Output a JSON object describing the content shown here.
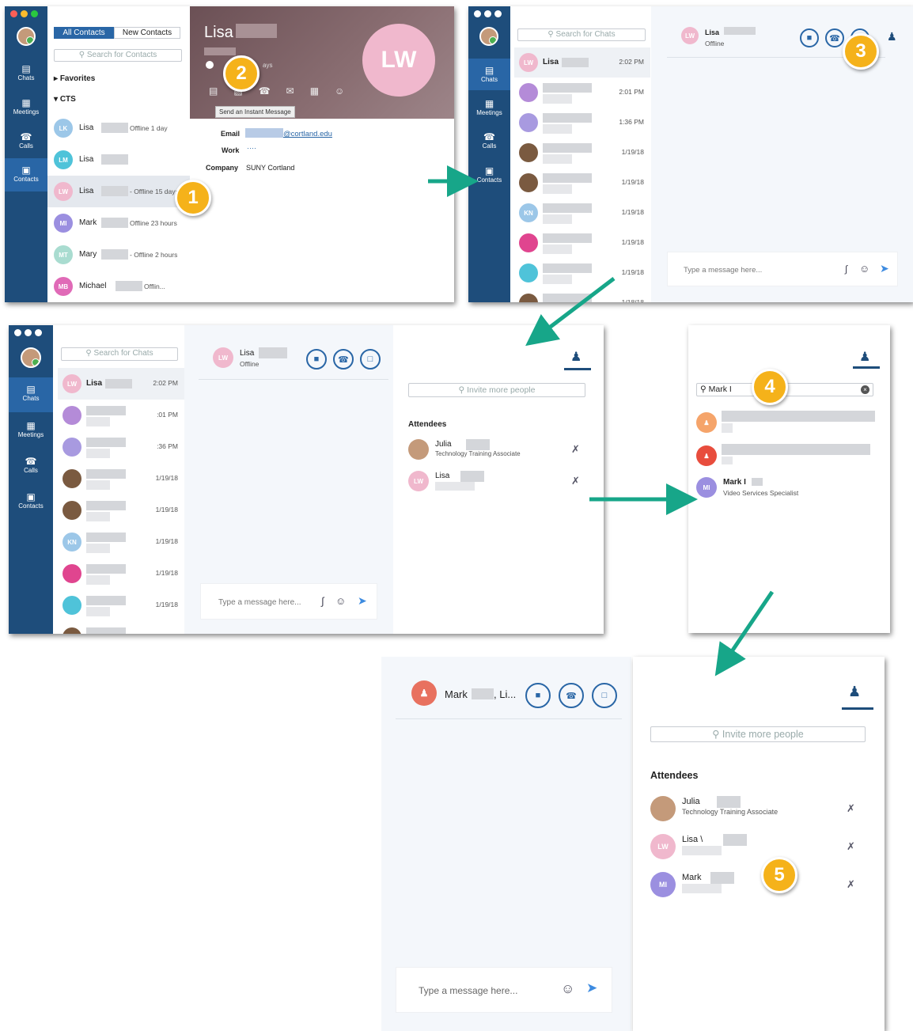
{
  "panel1": {
    "tabs": [
      "All Contacts",
      "New Contacts"
    ],
    "search_placeholder": "Search for Contacts",
    "groups": [
      "Favorites",
      "CTS"
    ],
    "nav": [
      "Chats",
      "Meetings",
      "Calls",
      "Contacts"
    ],
    "contacts": [
      {
        "initials": "LK",
        "name": "Lisa",
        "status": "Offline 1 day",
        "color": "#9cc7e8"
      },
      {
        "initials": "LM",
        "name": "Lisa",
        "status": "",
        "color": "#4fc3d9"
      },
      {
        "initials": "LW",
        "name": "Lisa",
        "status": "- Offline 15 days",
        "color": "#f0b8cd"
      },
      {
        "initials": "MI",
        "name": "Mark",
        "status": "Offline 23 hours",
        "color": "#9b8fe0"
      },
      {
        "initials": "MT",
        "name": "Mary",
        "status": "- Offline 2 hours",
        "color": "#a9dcd0"
      },
      {
        "initials": "MB",
        "name": "Michael",
        "status": "Offlin...",
        "color": "#e06ab7"
      }
    ],
    "profile": {
      "name": "Lisa",
      "initials": "LW",
      "status_fragment": "ays",
      "tooltip": "Send an Instant Message",
      "email_label": "Email",
      "email_value": "@cortland.edu",
      "work_label": "Work",
      "work_value": "····",
      "company_label": "Company",
      "company_value": "SUNY Cortland"
    },
    "callout": "1",
    "callout2": "2"
  },
  "panel2": {
    "search_placeholder": "Search for Chats",
    "nav": [
      "Chats",
      "Meetings",
      "Calls",
      "Contacts"
    ],
    "chats": [
      {
        "initials": "LW",
        "name": "Lisa",
        "time": "2:02 PM",
        "color": "#f0b8cd"
      },
      {
        "initials": "",
        "name": "",
        "time": "2:01 PM",
        "color": "#b48bd8"
      },
      {
        "initials": "",
        "name": "",
        "time": "1:36 PM",
        "color": "#a89ae0"
      },
      {
        "initials": "",
        "name": "",
        "time": "1/19/18",
        "color": "#7a5a40"
      },
      {
        "initials": "",
        "name": "",
        "time": "1/19/18",
        "color": "#7a5a40"
      },
      {
        "initials": "KN",
        "name": "",
        "time": "1/19/18",
        "color": "#9cc7e8"
      },
      {
        "initials": "",
        "name": "",
        "time": "1/19/18",
        "color": "#e0458f"
      },
      {
        "initials": "",
        "name": "",
        "time": "1/19/18",
        "color": "#4fc3d9"
      },
      {
        "initials": "",
        "name": "",
        "time": "1/18/18",
        "color": "#7a5a40"
      }
    ],
    "header_name": "Lisa",
    "header_status": "Offline",
    "message_placeholder": "Type a message here...",
    "callout": "3"
  },
  "panel3": {
    "search_placeholder": "Search for Chats",
    "nav": [
      "Chats",
      "Meetings",
      "Calls",
      "Contacts"
    ],
    "chats": [
      {
        "initials": "LW",
        "name": "Lisa",
        "time": "2:02 PM",
        "color": "#f0b8cd"
      },
      {
        "initials": "",
        "name": "",
        "time": ":01 PM",
        "color": "#b48bd8"
      },
      {
        "initials": "",
        "name": "",
        "time": ":36 PM",
        "color": "#a89ae0"
      },
      {
        "initials": "",
        "name": "",
        "time": "1/19/18",
        "color": "#7a5a40"
      },
      {
        "initials": "",
        "name": "",
        "time": "1/19/18",
        "color": "#7a5a40"
      },
      {
        "initials": "KN",
        "name": "",
        "time": "1/19/18",
        "color": "#9cc7e8"
      },
      {
        "initials": "",
        "name": "",
        "time": "1/19/18",
        "color": "#e0458f"
      },
      {
        "initials": "",
        "name": "",
        "time": "1/19/18",
        "color": "#4fc3d9"
      },
      {
        "initials": "",
        "name": "",
        "time": "1/18/18",
        "color": "#7a5a40"
      }
    ],
    "header_name": "Lisa",
    "header_status": "Offline",
    "message_placeholder": "Type a message here...",
    "invite_placeholder": "Invite more people",
    "attendees_label": "Attendees",
    "attendees": [
      {
        "name": "Julia",
        "title": "Technology Training Associate",
        "initials": "",
        "color": "#c49a7a"
      },
      {
        "name": "Lisa",
        "title": "",
        "initials": "LW",
        "color": "#f0b8cd"
      }
    ]
  },
  "panel4": {
    "search_value": "Mark I",
    "result_name": "Mark I",
    "result_title": "Video Services Specialist",
    "result_initials": "MI",
    "callout": "4"
  },
  "panel5": {
    "header_name": "Mark",
    "header_suffix": ", Li...",
    "message_placeholder": "Type a message here...",
    "invite_placeholder": "Invite more people",
    "attendees_label": "Attendees",
    "attendees": [
      {
        "name": "Julia",
        "title": "Technology Training Associate",
        "initials": "",
        "color": "#c49a7a"
      },
      {
        "name": "Lisa \\",
        "title": "",
        "initials": "LW",
        "color": "#f0b8cd"
      },
      {
        "name": "Mark",
        "title": "",
        "initials": "MI",
        "color": "#9b8fe0"
      }
    ],
    "callout": "5"
  },
  "colors": {
    "sidebar": "#1e4d7b",
    "accent": "#2966a6",
    "callout": "#f5b21a",
    "arrow": "#17a689"
  }
}
